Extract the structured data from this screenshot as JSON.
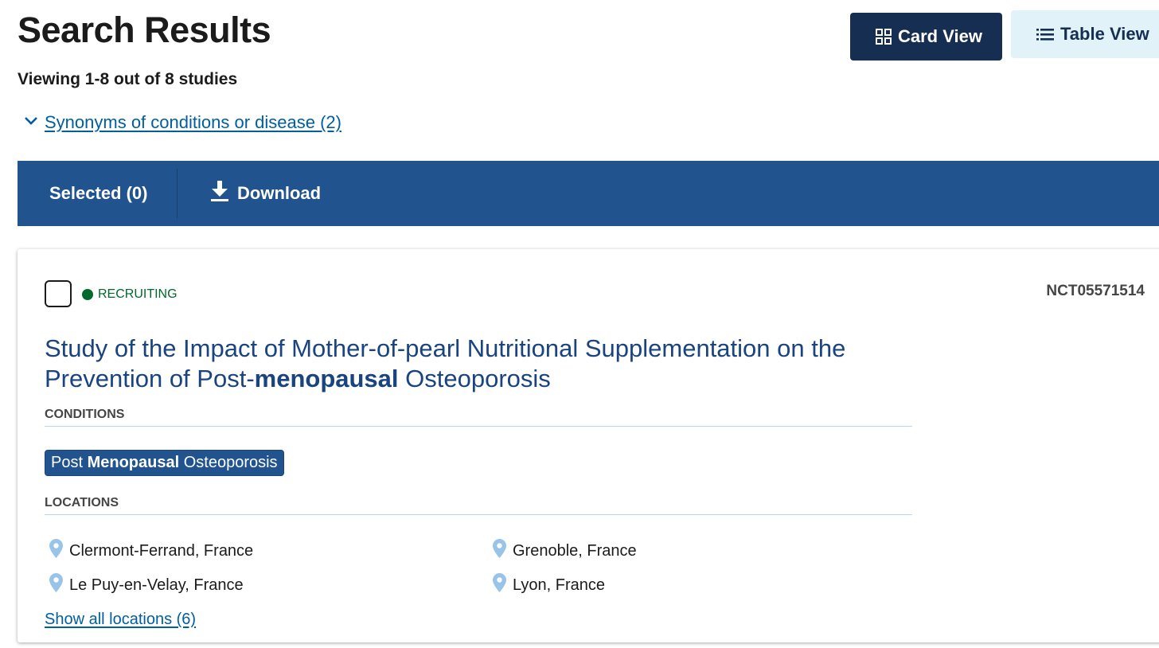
{
  "header": {
    "title": "Search Results",
    "count_text": "Viewing 1-8 out of 8 studies",
    "card_view_label": "Card View",
    "table_view_label": "Table View"
  },
  "synonyms": {
    "label": "Synonyms of conditions or disease (2)"
  },
  "toolbar": {
    "selected_label": "Selected (0)",
    "download_label": "Download"
  },
  "study": {
    "status": "RECRUITING",
    "nct_id": "NCT05571514",
    "title_prefix": "Study of the Impact of Mother-of-pearl Nutritional Supplementation on the Prevention of Post-",
    "title_highlight": "menopausal",
    "title_suffix": " Osteoporosis",
    "conditions_label": "CONDITIONS",
    "condition_tag": {
      "prefix": "Post ",
      "highlight": "Menopausal",
      "suffix": " Osteoporosis"
    },
    "locations_label": "LOCATIONS",
    "locations": [
      "Clermont-Ferrand, France",
      "Grenoble, France",
      "Le Puy-en-Velay, France",
      "Lyon, France"
    ],
    "show_all_label": "Show all locations (6)"
  },
  "colors": {
    "primary_dark": "#162e51",
    "toolbar_blue": "#21548f",
    "link_blue": "#005ea2",
    "title_blue": "#1a4480",
    "recruiting_green": "#00692b",
    "pin_light_blue": "#97c4e8"
  },
  "icons": [
    "grid-icon",
    "list-icon",
    "chevron-down-icon",
    "download-icon",
    "map-pin-icon"
  ]
}
